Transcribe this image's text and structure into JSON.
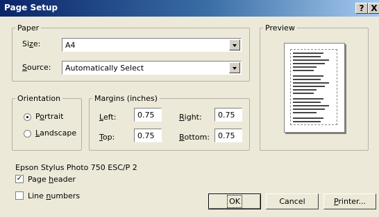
{
  "window": {
    "title": "Page Setup",
    "help_label": "?",
    "close_label": "X"
  },
  "paper": {
    "legend": "Paper",
    "size_label": "Size:",
    "size_value": "A4",
    "source_label": "Source:",
    "source_value": "Automatically Select"
  },
  "preview": {
    "legend": "Preview"
  },
  "orientation": {
    "legend": "Orientation",
    "portrait_label": "Portrait",
    "landscape_label": "Landscape",
    "selected": "Portrait"
  },
  "margins": {
    "legend": "Margins (inches)",
    "left_label": "Left:",
    "left_value": "0.75",
    "right_label": "Right:",
    "right_value": "0.75",
    "top_label": "Top:",
    "top_value": "0.75",
    "bottom_label": "Bottom:",
    "bottom_value": "0.75"
  },
  "printer_name": "Epson Stylus Photo 750 ESC/P 2",
  "options": {
    "page_header_label": "Page header",
    "page_header_checked": true,
    "line_numbers_label": "Line numbers",
    "line_numbers_checked": false
  },
  "buttons": {
    "ok": "OK",
    "cancel": "Cancel",
    "printer": "Printer..."
  },
  "colors": {
    "titlebar_start": "#0a246a",
    "titlebar_end": "#a6caf0",
    "dialog_bg": "#ece9d8"
  },
  "icons": {
    "check": "check-icon",
    "dropdown": "chevron-down-icon",
    "radio": "radio-dot-icon"
  }
}
